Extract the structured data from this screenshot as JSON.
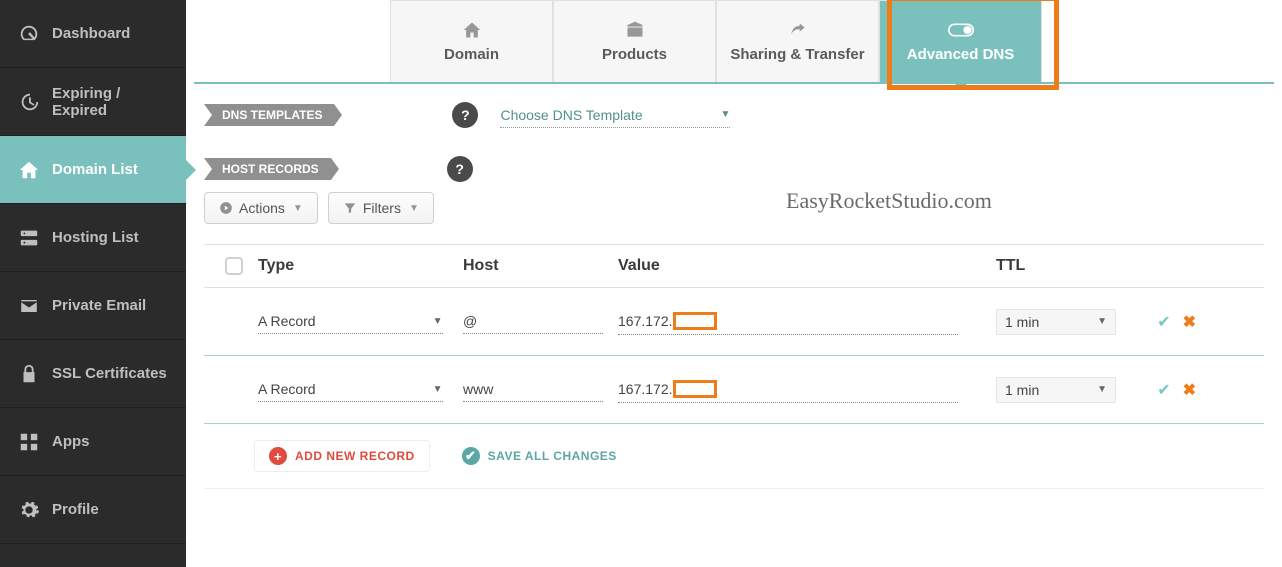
{
  "sidebar": {
    "items": [
      {
        "label": "Dashboard",
        "icon": "gauge-icon"
      },
      {
        "label": "Expiring / Expired",
        "icon": "clock-rewind-icon"
      },
      {
        "label": "Domain List",
        "icon": "home-icon",
        "active": true
      },
      {
        "label": "Hosting List",
        "icon": "server-icon"
      },
      {
        "label": "Private Email",
        "icon": "envelope-icon"
      },
      {
        "label": "SSL Certificates",
        "icon": "lock-icon"
      },
      {
        "label": "Apps",
        "icon": "apps-icon"
      },
      {
        "label": "Profile",
        "icon": "gear-icon"
      }
    ]
  },
  "tabs": {
    "items": [
      {
        "label": "Domain",
        "icon": "home-solid-icon"
      },
      {
        "label": "Products",
        "icon": "box-icon"
      },
      {
        "label": "Sharing & Transfer",
        "icon": "share-icon"
      },
      {
        "label": "Advanced DNS",
        "icon": "switch-icon",
        "active": true
      }
    ]
  },
  "sections": {
    "dns_templates_label": "DNS TEMPLATES",
    "dns_template_placeholder": "Choose DNS Template",
    "host_records_label": "HOST RECORDS"
  },
  "toolbar": {
    "actions_label": "Actions",
    "filters_label": "Filters"
  },
  "table": {
    "headers": {
      "type": "Type",
      "host": "Host",
      "value": "Value",
      "ttl": "TTL"
    },
    "rows": [
      {
        "type_label": "A Record",
        "host": "@",
        "value_prefix": "167.172.",
        "value_redacted": true,
        "ttl_label": "1 min"
      },
      {
        "type_label": "A Record",
        "host": "www",
        "value_prefix": "167.172.",
        "value_redacted": true,
        "ttl_label": "1 min"
      }
    ]
  },
  "footer": {
    "add_label": "ADD NEW RECORD",
    "save_label": "SAVE ALL CHANGES"
  },
  "watermark": "EasyRocketStudio.com",
  "colors": {
    "accent": "#7ac1bd",
    "highlight": "#ef7c1a"
  }
}
